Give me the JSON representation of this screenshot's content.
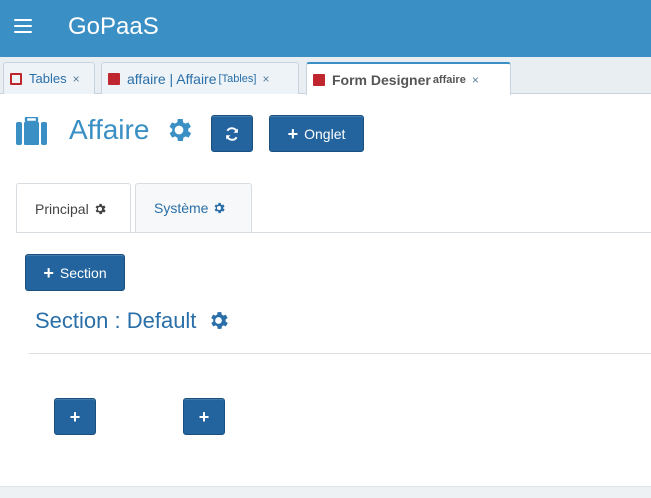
{
  "header": {
    "title": "GoPaaS",
    "menu_icon": "hamburger-icon",
    "background": "#3a8fc4"
  },
  "tabs": [
    {
      "label": "Tables",
      "sub": "",
      "icon": "table-icon-outline"
    },
    {
      "label": "affaire | Affaire",
      "sub": "[Tables]",
      "icon": "table-icon-solid"
    },
    {
      "label": "Form Designer",
      "sub": "affaire",
      "icon": "table-icon-solid",
      "active": true
    }
  ],
  "tab_close": "×",
  "page": {
    "title": "Affaire",
    "entity_icon": "briefcase-icon",
    "refresh_icon": "refresh-icon",
    "onglet_label": "Onglet"
  },
  "inner_tabs": [
    {
      "label": "Principal",
      "active": true
    },
    {
      "label": "Système",
      "active": false
    }
  ],
  "section": {
    "add_label": "Section",
    "title": "Section : Default"
  },
  "colors": {
    "accent": "#3a8fc4",
    "button": "#23649e",
    "tab_icon": "#c0262d"
  }
}
